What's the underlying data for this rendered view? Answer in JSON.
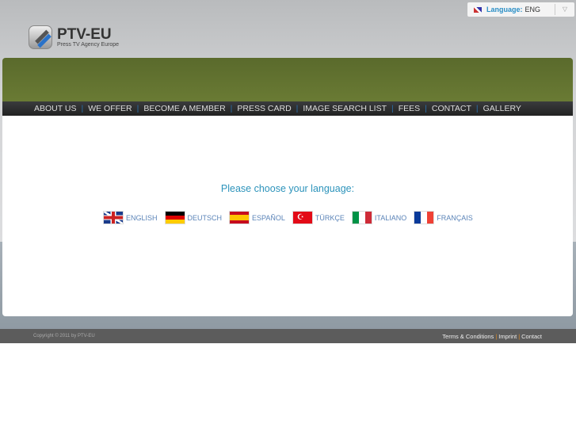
{
  "logo": {
    "title": "PTV-EU",
    "subtitle": "Press TV Agency Europe"
  },
  "language_selector": {
    "label": "Language:",
    "value": "ENG"
  },
  "nav": [
    "ABOUT US",
    "WE OFFER",
    "BECOME A MEMBER",
    "PRESS CARD",
    "IMAGE SEARCH LIST",
    "FEES",
    "CONTACT",
    "GALLERY"
  ],
  "main": {
    "prompt": "Please choose your language:",
    "languages": [
      {
        "label": "ENGLISH",
        "flag": "uk"
      },
      {
        "label": "DEUTSCH",
        "flag": "de"
      },
      {
        "label": "ESPAÑOL",
        "flag": "es"
      },
      {
        "label": "TÜRKÇE",
        "flag": "tr"
      },
      {
        "label": "ITALIANO",
        "flag": "it"
      },
      {
        "label": "FRANÇAIS",
        "flag": "fr"
      }
    ]
  },
  "footer": {
    "copyright": "Copyright © 2011 by PTV-EU",
    "links": [
      "Terms & Conditions",
      "Imprint",
      "Contact"
    ]
  }
}
